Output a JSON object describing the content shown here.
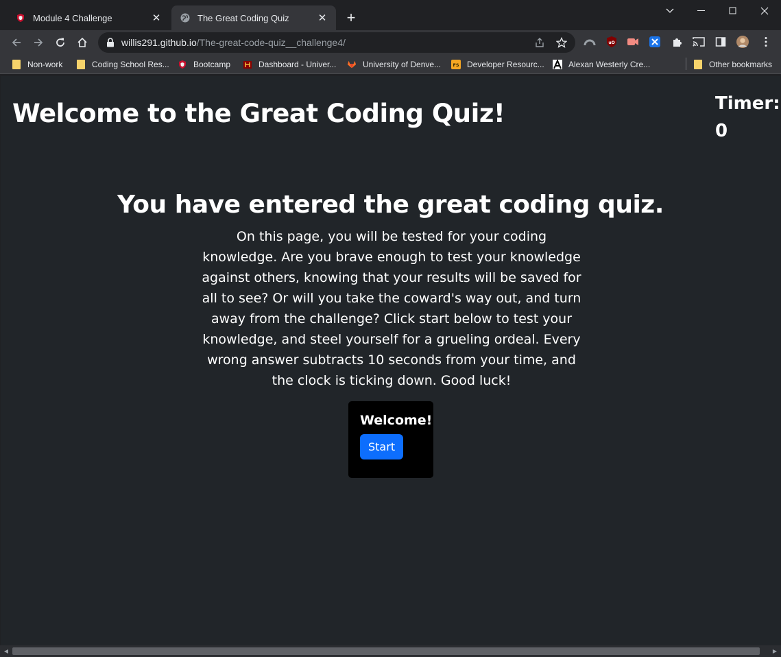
{
  "browser": {
    "tabs": [
      {
        "title": "Module 4 Challenge",
        "active": false,
        "icon": "shield-icon"
      },
      {
        "title": "The Great Coding Quiz",
        "active": true,
        "icon": "globe-icon"
      }
    ],
    "address_host": "willis291.github.io",
    "address_path": "/The-great-code-quiz__challenge4/",
    "bookmarks": [
      {
        "label": "Non-work",
        "icon": "folder-icon"
      },
      {
        "label": "Coding School Res...",
        "icon": "folder-icon"
      },
      {
        "label": "Bootcamp",
        "icon": "shield-icon"
      },
      {
        "label": "Dashboard - Univer...",
        "icon": "university-icon"
      },
      {
        "label": "University of Denve...",
        "icon": "gitlab-icon"
      },
      {
        "label": "Developer Resourc...",
        "icon": "fs-icon"
      },
      {
        "label": "Alexan Westerly Cre...",
        "icon": "a-icon"
      }
    ],
    "other_bookmarks": "Other bookmarks",
    "colors": {
      "accent": "#0d6efd",
      "page_bg": "#212529",
      "chrome_bg": "#35363a"
    }
  },
  "page": {
    "title": "Welcome to the Great Coding Quiz!",
    "timer_label": "Timer:",
    "timer_value": "0",
    "intro_heading": "You have entered the great coding quiz.",
    "intro_text": "On this page, you will be tested for your coding knowledge. Are you brave enough to test your knowledge against others, knowing that your results will be saved for all to see? Or will you take the coward's way out, and turn away from the challenge? Click start below to test your knowledge, and steel yourself for a grueling ordeal. Every wrong answer subtracts 10 seconds from your time, and the clock is ticking down. Good luck!",
    "card_title": "Welcome!",
    "start_label": "Start"
  }
}
